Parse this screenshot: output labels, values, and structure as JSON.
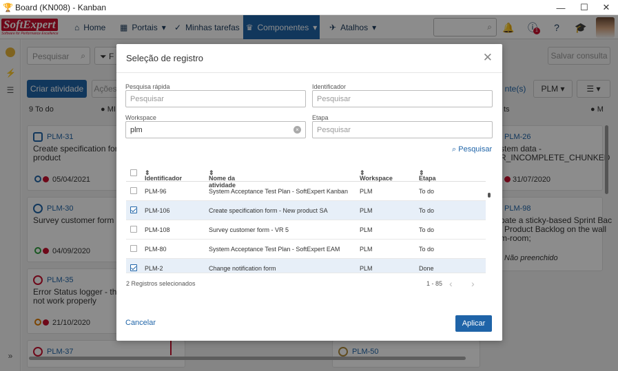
{
  "window": {
    "title": "Board (KN008) - Kanban",
    "minimize": "—",
    "maximize": "☐",
    "close": "✕"
  },
  "nav": {
    "logo": {
      "text": "SoftExpert",
      "tagline": "Software for Performance Excellence"
    },
    "items": [
      {
        "label": "Home",
        "icon": "home-icon",
        "glyph": "⌂"
      },
      {
        "label": "Portais",
        "icon": "grid-icon",
        "glyph": "▦"
      },
      {
        "label": "Minhas tarefas",
        "icon": "check-icon",
        "glyph": "✓"
      },
      {
        "label": "Componentes",
        "icon": "trophy-icon",
        "glyph": "🏆"
      },
      {
        "label": "Atalhos",
        "icon": "rocket-icon",
        "glyph": "✈"
      }
    ],
    "notification_count": "1"
  },
  "toolbar": {
    "search_placeholder": "Pesquisar",
    "filter_label": "F",
    "save_query": "Salvar consulta",
    "create_activity": "Criar atividade",
    "actions": "Ações",
    "responsible": "nte(s)",
    "workspace_filter": "PLM"
  },
  "columns": [
    {
      "header": "9 To do"
    },
    {
      "header": "MI"
    },
    {
      "header": "ts"
    },
    {
      "header": "M"
    }
  ],
  "cards": [
    {
      "id": "PLM-31",
      "title": "Create specification form\nproduct",
      "date": "05/04/2021"
    },
    {
      "id": "PLM-30",
      "title": "Survey customer form - V",
      "date": "04/09/2020"
    },
    {
      "id": "PLM-35",
      "title": "Error Status logger - the\nnot work properly",
      "date": "21/10/2020"
    },
    {
      "id": "PLM-37",
      "title": "",
      "date": ""
    },
    {
      "id": "PLM-26",
      "title": "stem data -\nR_INCOMPLETE_CHUNKED",
      "date": "31/07/2020"
    },
    {
      "id": "PLM-98",
      "title": "pate a sticky-based Sprint Bac\nl Product Backlog on the wall\nm-room;",
      "date": "Não preenchido"
    },
    {
      "id": "PLM-50",
      "title": "",
      "date": ""
    }
  ],
  "modal": {
    "title": "Seleção de registro",
    "fields": {
      "quick_search_label": "Pesquisa rápida",
      "quick_search_placeholder": "Pesquisar",
      "identifier_label": "Identificador",
      "identifier_placeholder": "Pesquisar",
      "workspace_label": "Workspace",
      "workspace_value": "plm",
      "stage_label": "Etapa",
      "stage_placeholder": "Pesquisar"
    },
    "search_button": "Pesquisar",
    "table": {
      "headers": [
        "Identificador",
        "Nome da atividade",
        "Workspace",
        "Etapa"
      ],
      "rows": [
        {
          "selected": false,
          "id": "PLM-96",
          "name": "System Acceptance Test Plan - SoftExpert Kanban",
          "workspace": "PLM",
          "stage": "To do"
        },
        {
          "selected": true,
          "id": "PLM-106",
          "name": "Create specification form - New product SA",
          "workspace": "PLM",
          "stage": "To do"
        },
        {
          "selected": false,
          "id": "PLM-108",
          "name": "Survey customer form - VR 5",
          "workspace": "PLM",
          "stage": "To do"
        },
        {
          "selected": false,
          "id": "PLM-80",
          "name": "System Acceptance Test Plan - SoftExpert EAM",
          "workspace": "PLM",
          "stage": "To do"
        },
        {
          "selected": true,
          "id": "PLM-2",
          "name": "Change notification form",
          "workspace": "PLM",
          "stage": "Done"
        }
      ]
    },
    "selected_info": "2 Registros selecionados",
    "pagination": "1 - 85",
    "cancel": "Cancelar",
    "apply": "Aplicar"
  }
}
